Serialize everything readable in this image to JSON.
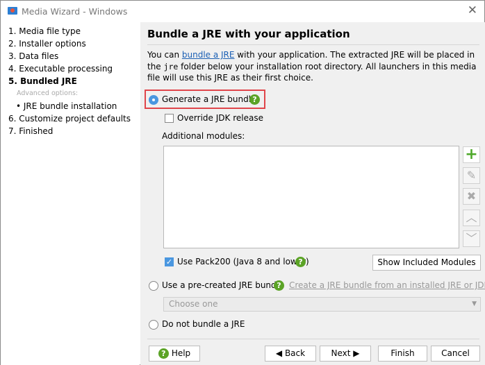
{
  "window": {
    "title": "Media Wizard - Windows"
  },
  "sidebar": {
    "items": [
      {
        "label": "1. Media file type"
      },
      {
        "label": "2. Installer options"
      },
      {
        "label": "3. Data files"
      },
      {
        "label": "4. Executable processing"
      },
      {
        "label": "5. Bundled JRE",
        "active": true
      },
      {
        "label": "Advanced options:"
      },
      {
        "label": "•  JRE bundle installation"
      },
      {
        "label": "6. Customize project defaults"
      },
      {
        "label": "7. Finished"
      }
    ]
  },
  "main": {
    "heading": "Bundle a JRE with your application",
    "desc_pre": "You can ",
    "desc_link": "bundle a JRE",
    "desc_mid": " with your application. The extracted JRE will be placed in the ",
    "desc_code": "jre",
    "desc_post": " folder below your installation root directory. All launchers in this media file will use this JRE as their first choice.",
    "generate_label": "Generate a JRE bundle",
    "override_label": "Override JDK release",
    "modules_label": "Additional modules:",
    "pack200_label": "Use Pack200 (Java 8 and lower)",
    "show_modules": "Show Included Modules",
    "precreated_label": "Use a pre-created JRE bundle",
    "create_link": "Create a JRE bundle from an installed JRE or JDK",
    "dropdown_value": "Choose one",
    "nobundle_label": "Do not bundle a JRE",
    "selected_option": "generate",
    "override_checked": false,
    "pack200_checked": true
  },
  "footer": {
    "help": "Help",
    "back": "Back",
    "next": "Next",
    "finish": "Finish",
    "cancel": "Cancel"
  },
  "colors": {
    "accent": "#4a97e0",
    "help": "#5ba326",
    "highlight": "#e0454a"
  }
}
